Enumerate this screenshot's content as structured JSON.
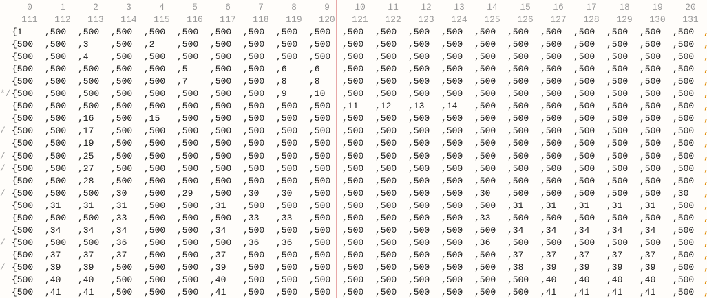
{
  "header_row_1": [
    "0",
    "1",
    "2",
    "3",
    "4",
    "5",
    "6",
    "7",
    "8",
    "9",
    "10",
    "11",
    "12",
    "13",
    "14",
    "15",
    "16",
    "17",
    "18",
    "19",
    "20"
  ],
  "header_row_2": [
    "111",
    "112",
    "113",
    "114",
    "115",
    "116",
    "117",
    "118",
    "119",
    "120",
    "121",
    "122",
    "123",
    "124",
    "125",
    "126",
    "127",
    "128",
    "129",
    "130",
    "131"
  ],
  "colors": {
    "text": "#1a1a1a",
    "header": "#9a9a9a",
    "divider": "#e8a8a8",
    "edge_marker": "#e08a00"
  },
  "rows": [
    {
      "prefix": "",
      "cells": [
        "{1",
        ",500",
        ",500",
        ",500",
        ",500",
        ",500",
        ",500",
        ",500",
        ",500",
        ",500",
        ",500",
        ",500",
        ",500",
        ",500",
        ",500",
        ",500",
        ",500",
        ",500",
        ",500",
        ",500",
        ",500"
      ]
    },
    {
      "prefix": "",
      "cells": [
        "{500",
        ",500",
        ",3",
        ",500",
        ",2",
        ",500",
        ",500",
        ",500",
        ",500",
        ",500",
        ",500",
        ",500",
        ",500",
        ",500",
        ",500",
        ",500",
        ",500",
        ",500",
        ",500",
        ",500",
        ",500"
      ]
    },
    {
      "prefix": "",
      "cells": [
        "{500",
        ",500",
        ",4",
        ",500",
        ",500",
        ",500",
        ",500",
        ",500",
        ",500",
        ",500",
        ",500",
        ",500",
        ",500",
        ",500",
        ",500",
        ",500",
        ",500",
        ",500",
        ",500",
        ",500",
        ",500"
      ]
    },
    {
      "prefix": "",
      "cells": [
        "{500",
        ",500",
        ",500",
        ",500",
        ",500",
        ",5",
        ",500",
        ",500",
        ",6",
        ",6",
        ",500",
        ",500",
        ",500",
        ",500",
        ",500",
        ",500",
        ",500",
        ",500",
        ",500",
        ",500",
        ",500"
      ]
    },
    {
      "prefix": "",
      "cells": [
        "{500",
        ",500",
        ",500",
        ",500",
        ",500",
        ",7",
        ",500",
        ",500",
        ",8",
        ",8",
        ",500",
        ",500",
        ",500",
        ",500",
        ",500",
        ",500",
        ",500",
        ",500",
        ",500",
        ",500",
        ",500"
      ]
    },
    {
      "prefix": "*/",
      "cells": [
        "{500",
        ",500",
        ",500",
        ",500",
        ",500",
        ",500",
        ",500",
        ",500",
        ",9",
        ",10",
        ",500",
        ",500",
        ",500",
        ",500",
        ",500",
        ",500",
        ",500",
        ",500",
        ",500",
        ",500",
        ",500"
      ]
    },
    {
      "prefix": "",
      "cells": [
        "{500",
        ",500",
        ",500",
        ",500",
        ",500",
        ",500",
        ",500",
        ",500",
        ",500",
        ",500",
        ",11",
        ",12",
        ",13",
        ",14",
        ",500",
        ",500",
        ",500",
        ",500",
        ",500",
        ",500",
        ",500"
      ]
    },
    {
      "prefix": "",
      "cells": [
        "{500",
        ",500",
        ",16",
        ",500",
        ",15",
        ",500",
        ",500",
        ",500",
        ",500",
        ",500",
        ",500",
        ",500",
        ",500",
        ",500",
        ",500",
        ",500",
        ",500",
        ",500",
        ",500",
        ",500",
        ",500"
      ]
    },
    {
      "prefix": "/",
      "cells": [
        "{500",
        ",500",
        ",17",
        ",500",
        ",500",
        ",500",
        ",500",
        ",500",
        ",500",
        ",500",
        ",500",
        ",500",
        ",500",
        ",500",
        ",500",
        ",500",
        ",500",
        ",500",
        ",500",
        ",500",
        ",500"
      ]
    },
    {
      "prefix": "",
      "cells": [
        "{500",
        ",500",
        ",19",
        ",500",
        ",500",
        ",500",
        ",500",
        ",500",
        ",500",
        ",500",
        ",500",
        ",500",
        ",500",
        ",500",
        ",500",
        ",500",
        ",500",
        ",500",
        ",500",
        ",500",
        ",500"
      ]
    },
    {
      "prefix": "/",
      "cells": [
        "{500",
        ",500",
        ",25",
        ",500",
        ",500",
        ",500",
        ",500",
        ",500",
        ",500",
        ",500",
        ",500",
        ",500",
        ",500",
        ",500",
        ",500",
        ",500",
        ",500",
        ",500",
        ",500",
        ",500",
        ",500"
      ]
    },
    {
      "prefix": "/",
      "cells": [
        "{500",
        ",500",
        ",27",
        ",500",
        ",500",
        ",500",
        ",500",
        ",500",
        ",500",
        ",500",
        ",500",
        ",500",
        ",500",
        ",500",
        ",500",
        ",500",
        ",500",
        ",500",
        ",500",
        ",500",
        ",500"
      ]
    },
    {
      "prefix": "",
      "cells": [
        "{500",
        ",500",
        ",28",
        ",500",
        ",500",
        ",500",
        ",500",
        ",500",
        ",500",
        ",500",
        ",500",
        ",500",
        ",500",
        ",500",
        ",500",
        ",500",
        ",500",
        ",500",
        ",500",
        ",500",
        ",500"
      ]
    },
    {
      "prefix": "/",
      "cells": [
        "{500",
        ",500",
        ",500",
        ",30",
        ",500",
        ",29",
        ",500",
        ",30",
        ",30",
        ",500",
        ",500",
        ",500",
        ",500",
        ",500",
        ",30",
        ",500",
        ",500",
        ",500",
        ",500",
        ",500",
        ",30"
      ]
    },
    {
      "prefix": "",
      "cells": [
        "{500",
        ",31",
        ",31",
        ",31",
        ",500",
        ",500",
        ",31",
        ",500",
        ",500",
        ",500",
        ",500",
        ",500",
        ",500",
        ",500",
        ",500",
        ",31",
        ",31",
        ",31",
        ",31",
        ",31",
        ",500"
      ]
    },
    {
      "prefix": "",
      "cells": [
        "{500",
        ",500",
        ",500",
        ",33",
        ",500",
        ",500",
        ",500",
        ",33",
        ",33",
        ",500",
        ",500",
        ",500",
        ",500",
        ",500",
        ",33",
        ",500",
        ",500",
        ",500",
        ",500",
        ",500",
        ",500"
      ]
    },
    {
      "prefix": "",
      "cells": [
        "{500",
        ",34",
        ",34",
        ",34",
        ",500",
        ",500",
        ",34",
        ",500",
        ",500",
        ",500",
        ",500",
        ",500",
        ",500",
        ",500",
        ",500",
        ",34",
        ",34",
        ",34",
        ",34",
        ",34",
        ",500"
      ]
    },
    {
      "prefix": "/",
      "cells": [
        "{500",
        ",500",
        ",500",
        ",36",
        ",500",
        ",500",
        ",500",
        ",36",
        ",36",
        ",500",
        ",500",
        ",500",
        ",500",
        ",500",
        ",36",
        ",500",
        ",500",
        ",500",
        ",500",
        ",500",
        ",500"
      ]
    },
    {
      "prefix": "",
      "cells": [
        "{500",
        ",37",
        ",37",
        ",37",
        ",500",
        ",500",
        ",37",
        ",500",
        ",500",
        ",500",
        ",500",
        ",500",
        ",500",
        ",500",
        ",500",
        ",37",
        ",37",
        ",37",
        ",37",
        ",37",
        ",500"
      ]
    },
    {
      "prefix": "/",
      "cells": [
        "{500",
        ",39",
        ",39",
        ",500",
        ",500",
        ",500",
        ",39",
        ",500",
        ",500",
        ",500",
        ",500",
        ",500",
        ",500",
        ",500",
        ",500",
        ",38",
        ",39",
        ",39",
        ",39",
        ",39",
        ",500"
      ]
    },
    {
      "prefix": "",
      "cells": [
        "{500",
        ",40",
        ",40",
        ",500",
        ",500",
        ",500",
        ",40",
        ",500",
        ",500",
        ",500",
        ",500",
        ",500",
        ",500",
        ",500",
        ",500",
        ",500",
        ",40",
        ",40",
        ",40",
        ",40",
        ",500"
      ]
    },
    {
      "prefix": "",
      "cells": [
        "{500",
        ",41",
        ",41",
        ",500",
        ",500",
        ",500",
        ",41",
        ",500",
        ",500",
        ",500",
        ",500",
        ",500",
        ",500",
        ",500",
        ",500",
        ",500",
        ",41",
        ",41",
        ",41",
        ",41",
        ",500"
      ]
    }
  ],
  "edge_marker": ","
}
